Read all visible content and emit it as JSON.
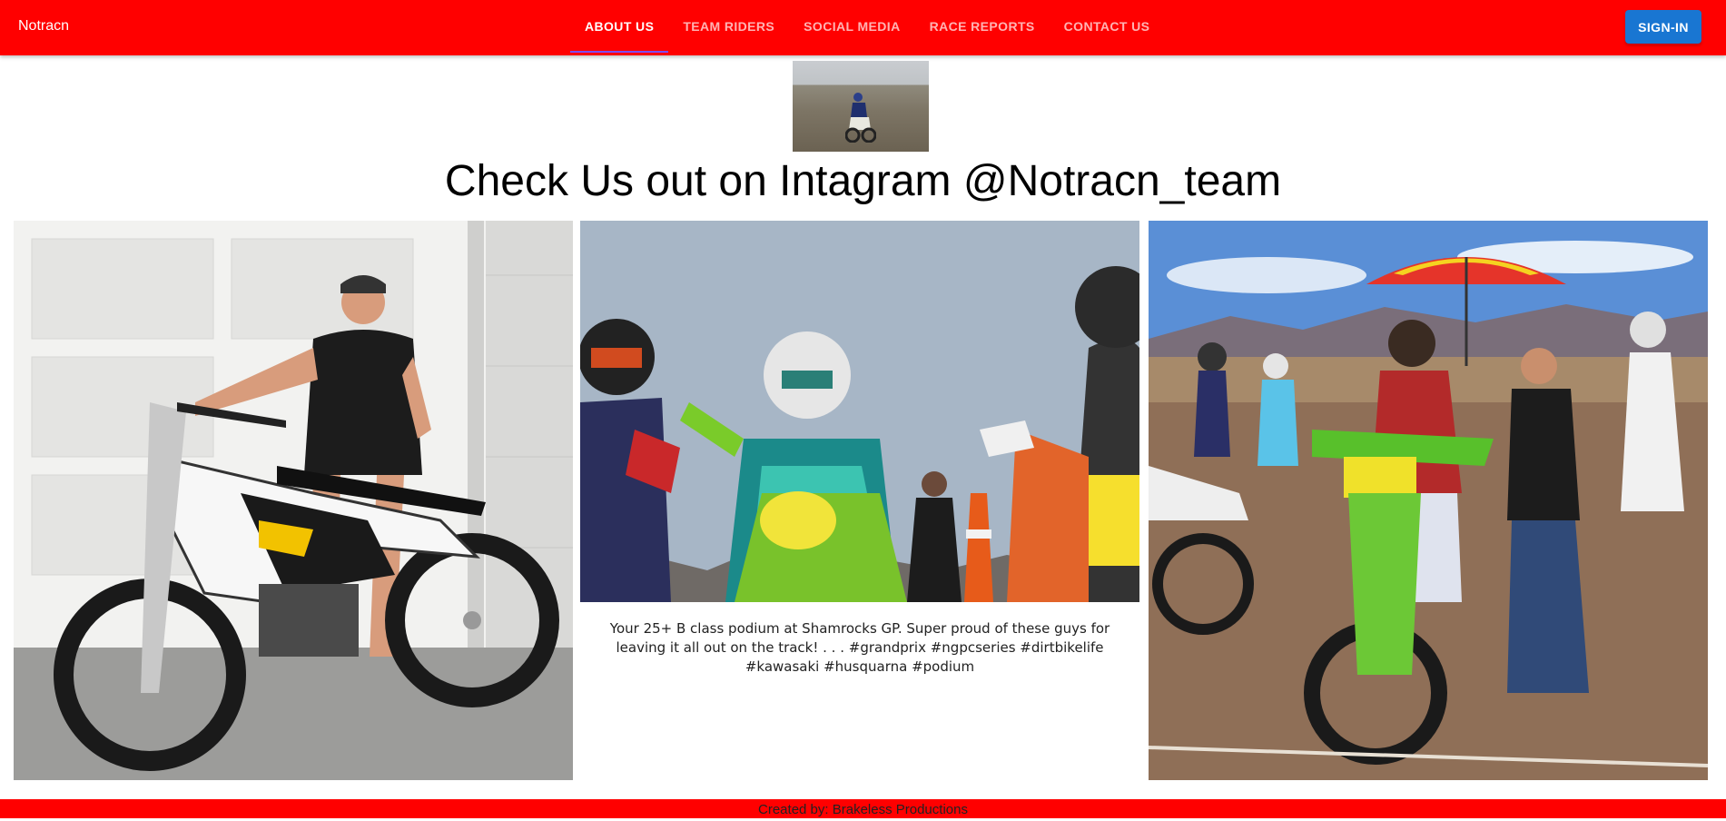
{
  "appbar": {
    "brand": "Notracn",
    "tabs": [
      {
        "label": "About Us",
        "active": true
      },
      {
        "label": "Team Riders",
        "active": false
      },
      {
        "label": "Social Media",
        "active": false
      },
      {
        "label": "Race Reports",
        "active": false
      },
      {
        "label": "Contact Us",
        "active": false
      }
    ],
    "signin_label": "Sign-in"
  },
  "main": {
    "title": "Check Us out on Intagram @Notracn_team",
    "photos": [
      {
        "name": "rider-with-dirtbike-photo"
      },
      {
        "name": "podium-riders-photo",
        "caption": "Your 25+ B class podium at Shamrocks GP. Super proud of these guys for leaving it all out on the track! . . . #grandprix #ngpcseries #dirtbikelife #kawasaki #husquarna #podium"
      },
      {
        "name": "starting-line-photo"
      }
    ]
  },
  "footer": {
    "text": "Created by: Brakeless Productions"
  },
  "colors": {
    "appbar": "#ff0000",
    "signin": "#1976d2",
    "active_tab_indicator": "#7c4dff",
    "footer": "#ff0000"
  }
}
